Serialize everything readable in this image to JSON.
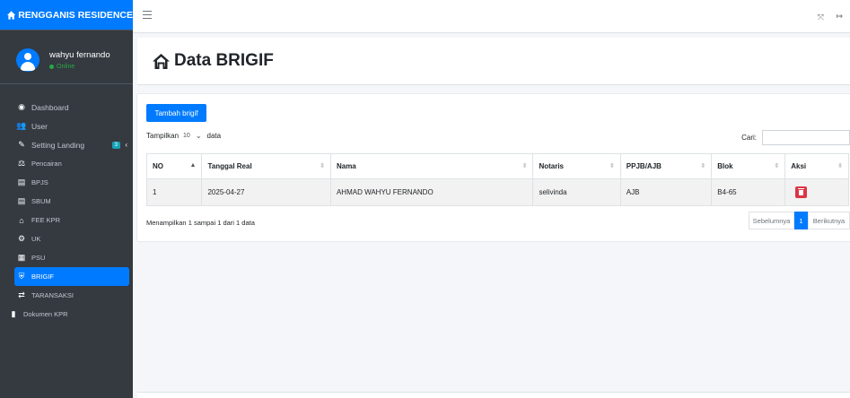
{
  "brand": {
    "title": "RENGGANIS RESIDENCE"
  },
  "user": {
    "name": "wahyu fernando",
    "status": "Online"
  },
  "sidebar": {
    "items": [
      {
        "label": "Dashboard",
        "icon": "dashboard-icon"
      },
      {
        "label": "User",
        "icon": "users-icon"
      },
      {
        "label": "Setting Landing",
        "icon": "edit-icon",
        "badge": "3"
      },
      {
        "label": "Pencairan",
        "icon": "people-carry-icon"
      },
      {
        "label": "BPJS",
        "icon": "document-icon"
      },
      {
        "label": "SBUM",
        "icon": "document-icon"
      },
      {
        "label": "FEE KPR",
        "icon": "home-icon"
      },
      {
        "label": "UK",
        "icon": "cogs-icon"
      },
      {
        "label": "PSU",
        "icon": "building-icon"
      },
      {
        "label": "BRIGIF",
        "icon": "shield-icon",
        "active": true
      },
      {
        "label": "TARANSAKSI",
        "icon": "exchange-icon"
      },
      {
        "label": "Dokumen KPR",
        "icon": "file-icon"
      }
    ]
  },
  "page": {
    "title": "Data BRIGIF"
  },
  "toolbar": {
    "add_label": "Tambah brigif"
  },
  "table_controls": {
    "show_prefix": "Tampilkan",
    "page_length": "10",
    "show_suffix": "data",
    "search_label": "Cari:"
  },
  "table": {
    "headers": [
      "NO",
      "Tanggal Real",
      "Nama",
      "Notaris",
      "PPJB/AJB",
      "Blok",
      "Aksi"
    ],
    "rows": [
      [
        "1",
        "2025-04-27",
        "AHMAD WAHYU FERNANDO",
        "selivinda",
        "AJB",
        "B4-65",
        ""
      ]
    ]
  },
  "footer": {
    "info": "Menampilkan 1 sampai 1 dari 1 data"
  },
  "pagination": {
    "prev": "Sebelumnya",
    "current": "1",
    "next": "Berikutnya"
  },
  "colors": {
    "primary": "#007bff",
    "sidebar": "#343a40",
    "danger": "#dc3545",
    "success": "#28a745",
    "badge": "#17a2b8"
  }
}
